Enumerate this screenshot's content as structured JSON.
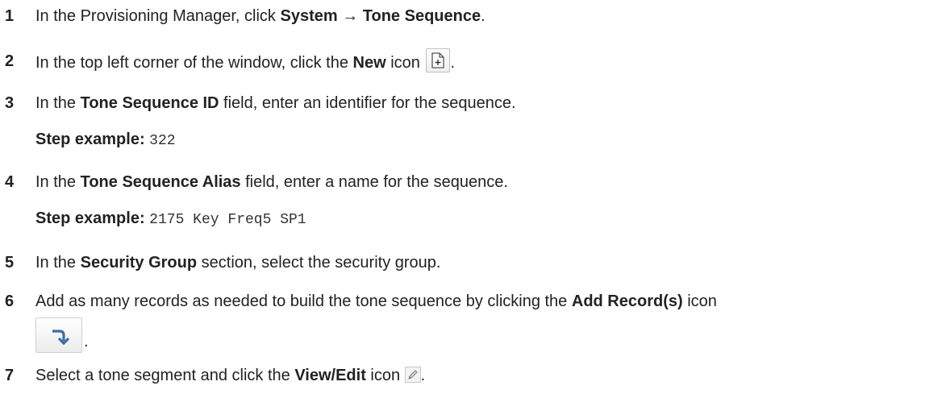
{
  "steps": [
    {
      "number": "1",
      "text_before": "In the Provisioning Manager, click ",
      "bold": "System → Tone Sequence",
      "text_after": "."
    },
    {
      "number": "2",
      "text_before": "In the top left corner of the window, click the ",
      "bold": "New",
      "text_after": " icon",
      "icon": "new-document-icon",
      "end": "."
    },
    {
      "number": "3",
      "text_before": "In the ",
      "bold": "Tone Sequence ID",
      "text_after": " field, enter an identifier for the sequence.",
      "example_label": "Step example:",
      "example_value": "322"
    },
    {
      "number": "4",
      "text_before": "In the ",
      "bold": "Tone Sequence Alias",
      "text_after": " field, enter a name for the sequence.",
      "example_label": "Step example:",
      "example_value": "2175 Key Freq5 SP1"
    },
    {
      "number": "5",
      "text_before": "In the ",
      "bold": "Security Group",
      "text_after": " section, select the security group."
    },
    {
      "number": "6",
      "text_before": "Add as many records as needed to build the tone sequence by clicking the ",
      "bold": "Add Record(s)",
      "text_after": " icon",
      "icon": "add-records-arrow-icon",
      "end": "."
    },
    {
      "number": "7",
      "text_before": "Select a tone segment and click the ",
      "bold": "View/Edit",
      "text_after": " icon",
      "icon": "pencil-edit-icon",
      "end": "."
    }
  ],
  "colors": {
    "text": "#222222",
    "icon_border": "#bfbfbf",
    "arrow": "#3a6fa8"
  }
}
